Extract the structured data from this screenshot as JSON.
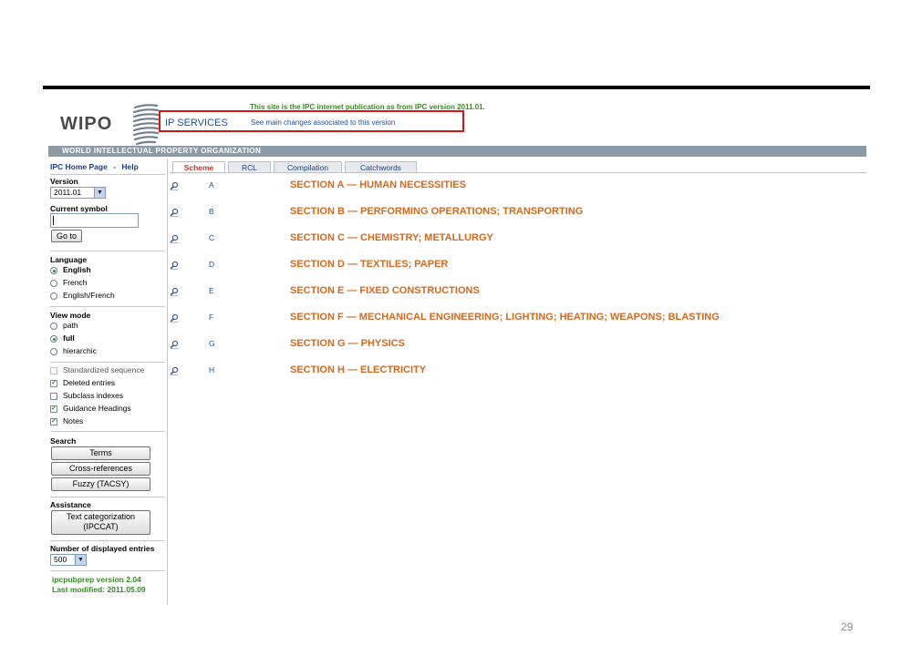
{
  "header": {
    "logo_text": "WIPO",
    "notice": "This site is the IPC internet publication as from IPC version 2011.01.",
    "ip_services": "IP SERVICES",
    "main_changes": "See main changes associated to this version",
    "org_name": "WORLD INTELLECTUAL PROPERTY ORGANIZATION"
  },
  "sidebar": {
    "home_link": "IPC Home Page",
    "sep": "-",
    "help_link": "Help",
    "version_label": "Version",
    "version_value": "2011.01",
    "current_symbol_label": "Current symbol",
    "current_symbol_value": "",
    "go_button": "Go to",
    "language_label": "Language",
    "languages": [
      "English",
      "French",
      "English/French"
    ],
    "language_selected": "English",
    "view_mode_label": "View mode",
    "view_modes": [
      "path",
      "full",
      "hierarchic"
    ],
    "view_mode_selected": "full",
    "options": [
      {
        "label": "Standardized sequence",
        "checked": false
      },
      {
        "label": "Deleted entries",
        "checked": true
      },
      {
        "label": "Subclass indexes",
        "checked": false
      },
      {
        "label": "Guidance Headings",
        "checked": true
      },
      {
        "label": "Notes",
        "checked": true
      }
    ],
    "search_label": "Search",
    "search_buttons": [
      "Terms",
      "Cross-references",
      "Fuzzy (TACSY)"
    ],
    "assistance_label": "Assistance",
    "text_cat_line1": "Text categorization",
    "text_cat_line2": "(IPCCAT)",
    "num_entries_label": "Number of displayed entries",
    "num_entries_value": "500",
    "footer_version": "ipcpubprep version 2.04",
    "footer_modified": "Last modified: 2011.05.09"
  },
  "tabs": [
    "Scheme",
    "RCL",
    "Compilation",
    "Catchwords"
  ],
  "active_tab": "Scheme",
  "sections": [
    {
      "letter": "A",
      "title": "SECTION A — HUMAN NECESSITIES"
    },
    {
      "letter": "B",
      "title": "SECTION B — PERFORMING OPERATIONS; TRANSPORTING"
    },
    {
      "letter": "C",
      "title": "SECTION C — CHEMISTRY; METALLURGY"
    },
    {
      "letter": "D",
      "title": "SECTION D — TEXTILES; PAPER"
    },
    {
      "letter": "E",
      "title": "SECTION E — FIXED CONSTRUCTIONS"
    },
    {
      "letter": "F",
      "title": "SECTION F — MECHANICAL ENGINEERING; LIGHTING; HEATING; WEAPONS; BLASTING"
    },
    {
      "letter": "G",
      "title": "SECTION G — PHYSICS"
    },
    {
      "letter": "H",
      "title": "SECTION H — ELECTRICITY"
    }
  ],
  "colors": {
    "section_title": "#d4681c",
    "link": "#1a4f9a",
    "highlight_box": "#d01818",
    "green_text": "#2f8f1f"
  },
  "icons": {
    "row_icon": "magnifier-icon",
    "dropdown": "chevron-down-icon"
  },
  "page_number": "29"
}
